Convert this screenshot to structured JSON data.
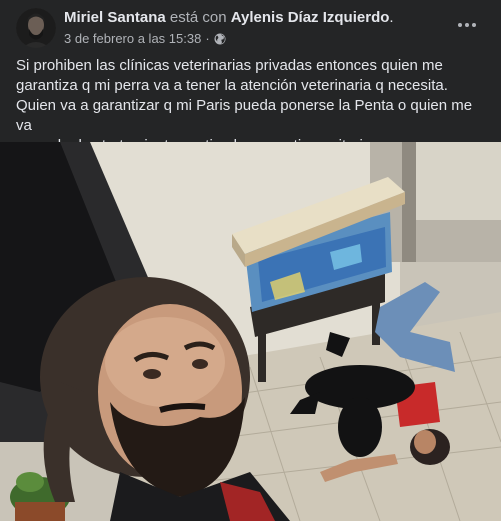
{
  "post": {
    "author": "Miriel Santana",
    "with_text": " está con ",
    "tagged": "Aylenis Díaz Izquierdo",
    "tagged_suffix": ".",
    "timestamp": "3 de febrero a las 15:38",
    "separator": "·",
    "privacy_icon": "globe-icon",
    "text_lines": [
      "Si prohiben las clínicas veterinarias privadas entonces quien me",
      "garantiza q mi perra va a tener la atención veterinaria q necesita.",
      "Quien va a garantizar q mi Paris pueda ponerse la Penta o quien me va",
      "a vender los tratamientos anti pulgas y antiparasitarios"
    ]
  },
  "colors": {
    "background": "#242526",
    "primary_text": "#e4e6eb",
    "secondary_text": "#b0b3b8"
  }
}
